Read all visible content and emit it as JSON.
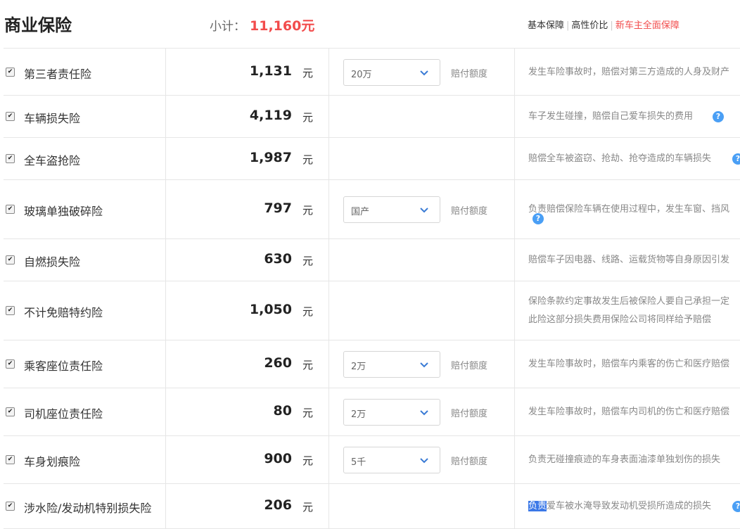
{
  "header": {
    "title": "商业保险",
    "subtotal_label": "小计：",
    "subtotal_value": "11,160元",
    "plans": [
      "基本保障",
      "高性价比",
      "新车主全面保障"
    ]
  },
  "unit": "元",
  "limit_label": "赔付额度",
  "help_glyph": "?",
  "rows": [
    {
      "name": "第三者责任险",
      "price": "1,131",
      "checked": true,
      "select": "20万",
      "desc": [
        "发生车险事故时，赔偿对第三方造成的人身及财产"
      ]
    },
    {
      "name": "车辆损失险",
      "price": "4,119",
      "checked": true,
      "desc": [
        "车子发生碰撞，赔偿自己爱车损失的费用"
      ]
    },
    {
      "name": "全车盗抢险",
      "price": "1,987",
      "checked": true,
      "desc": [
        "赔偿全车被盗窃、抢劫、抢夺造成的车辆损失"
      ]
    },
    {
      "name": "玻璃单独破碎险",
      "price": "797",
      "checked": true,
      "select": "国产",
      "desc": [
        "负责赔偿保险车辆在使用过程中，发生车窗、挡风"
      ]
    },
    {
      "name": "自燃损失险",
      "price": "630",
      "checked": true,
      "desc": [
        "赔偿车子因电器、线路、运载货物等自身原因引发"
      ]
    },
    {
      "name": "不计免赔特约险",
      "price": "1,050",
      "checked": true,
      "desc": [
        "保险条款约定事故发生后被保险人要自己承担一定",
        "此险这部分损失费用保险公司将同样给予赔偿"
      ]
    },
    {
      "name": "乘客座位责任险",
      "price": "260",
      "checked": true,
      "select": "2万",
      "desc": [
        "发生车险事故时，赔偿车内乘客的伤亡和医疗赔偿"
      ]
    },
    {
      "name": "司机座位责任险",
      "price": "80",
      "checked": true,
      "select": "2万",
      "desc": [
        "发生车险事故时，赔偿车内司机的伤亡和医疗赔偿"
      ]
    },
    {
      "name": "车身划痕险",
      "price": "900",
      "checked": true,
      "select": "5千",
      "desc": [
        "负责无碰撞痕迹的车身表面油漆单独划伤的损失"
      ]
    },
    {
      "name": "涉水险/发动机特别损失险",
      "price": "206",
      "checked": true,
      "desc": [
        "负责爱车被水淹导致发动机受损所造成的损失"
      ],
      "desc_highlight": "负责"
    }
  ],
  "colors": {
    "accent_red": "#f24c4c",
    "help_blue": "#4a9ff5",
    "border": "#e6e6e6"
  }
}
